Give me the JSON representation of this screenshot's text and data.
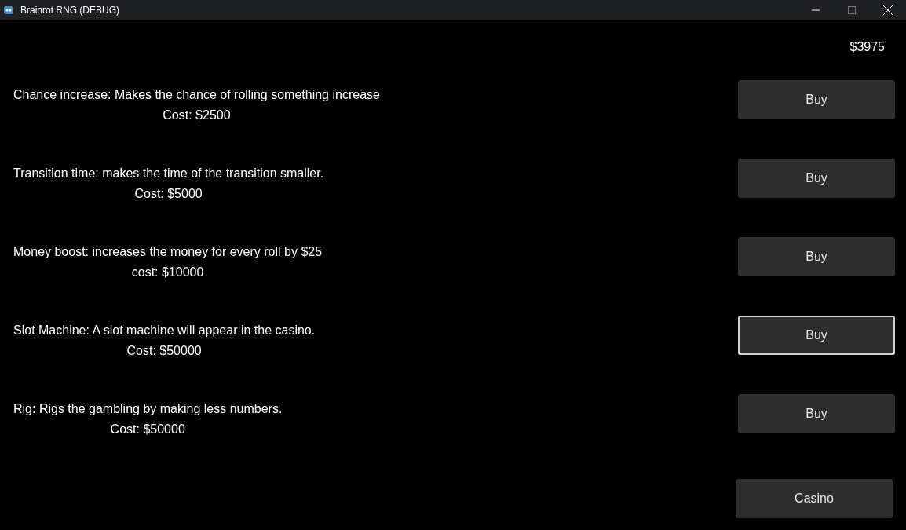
{
  "window": {
    "title": "Brainrot RNG (DEBUG)"
  },
  "money": "$3975",
  "upgrades": [
    {
      "description": "Chance increase: Makes the chance of rolling something increase",
      "cost": "Cost: $2500",
      "button": "Buy",
      "focused": false
    },
    {
      "description": "Transition time: makes the time of the transition smaller.",
      "cost": "Cost: $5000",
      "button": "Buy",
      "focused": false
    },
    {
      "description": "Money boost: increases the money for every roll by $25",
      "cost": "cost: $10000",
      "button": "Buy",
      "focused": false
    },
    {
      "description": "Slot Machine: A slot machine will appear in the casino.",
      "cost": "Cost: $50000",
      "button": "Buy",
      "focused": true
    },
    {
      "description": "Rig: Rigs the gambling by making less numbers.",
      "cost": "Cost: $50000",
      "button": "Buy",
      "focused": false
    }
  ],
  "casino_button": "Casino"
}
